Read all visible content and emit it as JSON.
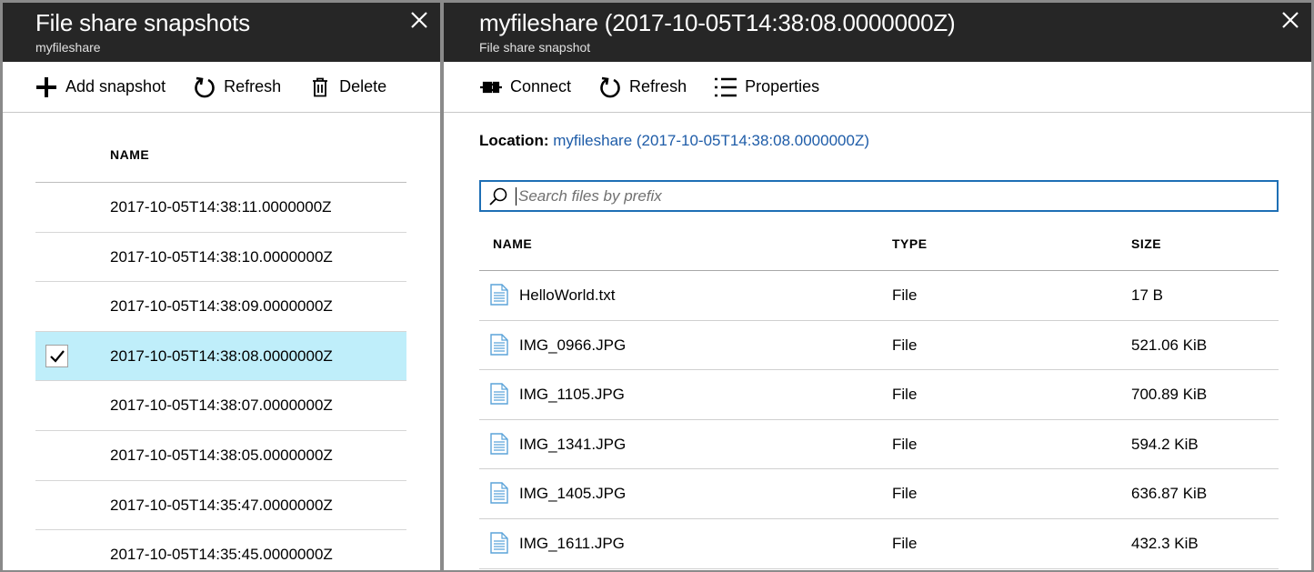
{
  "left_blade": {
    "title": "File share snapshots",
    "subtitle": "myfileshare",
    "toolbar": {
      "add_label": "Add snapshot",
      "refresh_label": "Refresh",
      "delete_label": "Delete"
    },
    "column_header": "NAME",
    "snapshots": [
      {
        "name": "2017-10-05T14:38:11.0000000Z",
        "selected": false
      },
      {
        "name": "2017-10-05T14:38:10.0000000Z",
        "selected": false
      },
      {
        "name": "2017-10-05T14:38:09.0000000Z",
        "selected": false
      },
      {
        "name": "2017-10-05T14:38:08.0000000Z",
        "selected": true
      },
      {
        "name": "2017-10-05T14:38:07.0000000Z",
        "selected": false
      },
      {
        "name": "2017-10-05T14:38:05.0000000Z",
        "selected": false
      },
      {
        "name": "2017-10-05T14:35:47.0000000Z",
        "selected": false
      },
      {
        "name": "2017-10-05T14:35:45.0000000Z",
        "selected": false
      }
    ]
  },
  "right_blade": {
    "title": "myfileshare (2017-10-05T14:38:08.0000000Z)",
    "subtitle": "File share snapshot",
    "toolbar": {
      "connect_label": "Connect",
      "refresh_label": "Refresh",
      "properties_label": "Properties"
    },
    "location": {
      "label": "Location:",
      "link": "myfileshare (2017-10-05T14:38:08.0000000Z)"
    },
    "search": {
      "placeholder": "Search files by prefix",
      "value": ""
    },
    "columns": {
      "name": "NAME",
      "type": "TYPE",
      "size": "SIZE"
    },
    "files": [
      {
        "name": "HelloWorld.txt",
        "type": "File",
        "size": "17 B"
      },
      {
        "name": "IMG_0966.JPG",
        "type": "File",
        "size": "521.06 KiB"
      },
      {
        "name": "IMG_1105.JPG",
        "type": "File",
        "size": "700.89 KiB"
      },
      {
        "name": "IMG_1341.JPG",
        "type": "File",
        "size": "594.2 KiB"
      },
      {
        "name": "IMG_1405.JPG",
        "type": "File",
        "size": "636.87 KiB"
      },
      {
        "name": "IMG_1611.JPG",
        "type": "File",
        "size": "432.3 KiB"
      }
    ]
  },
  "colors": {
    "header_bg": "#262626",
    "selected_row": "#bfeefa",
    "link": "#1e5ca8",
    "search_border": "#1e6fb5"
  },
  "icons": {
    "add": "plus-icon",
    "refresh": "refresh-icon",
    "delete": "trash-icon",
    "connect": "plug-icon",
    "properties": "list-icon",
    "close": "close-icon",
    "search": "search-icon",
    "file": "file-icon",
    "check": "checkmark-icon"
  }
}
